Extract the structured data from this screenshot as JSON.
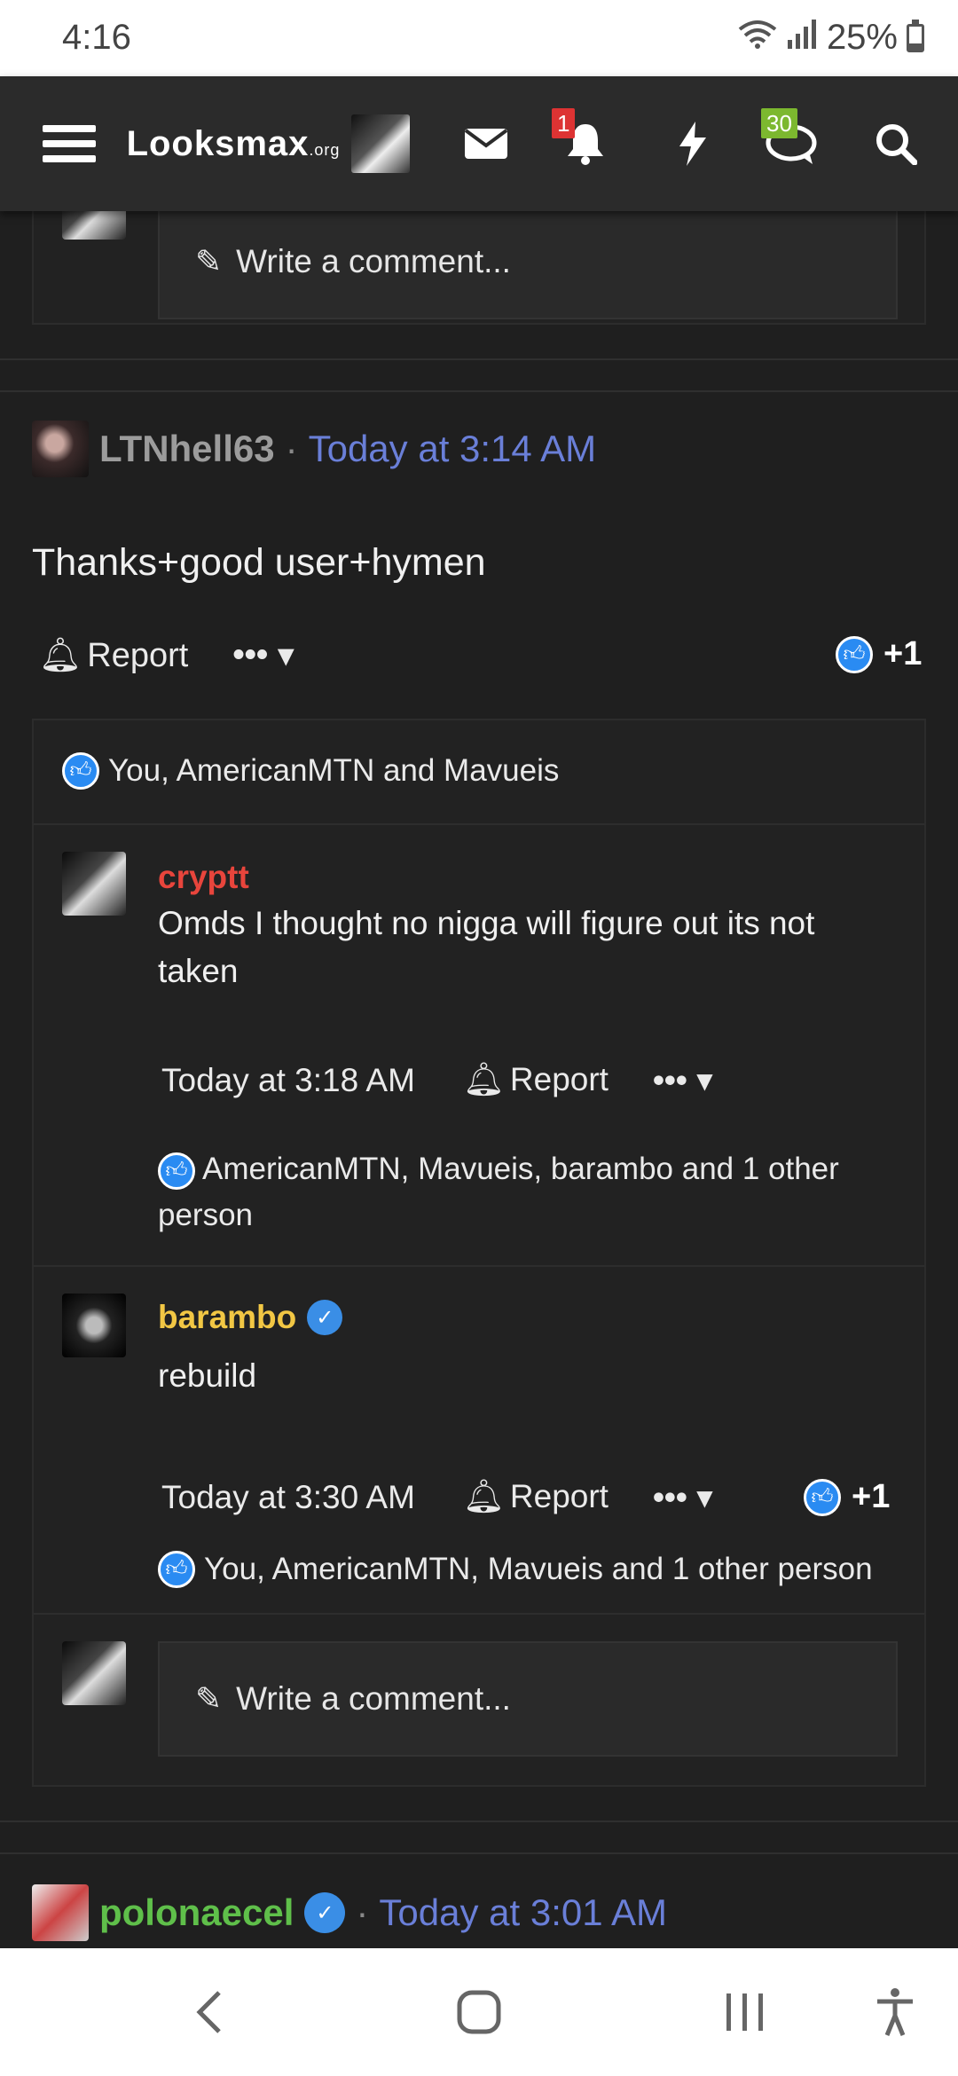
{
  "status_bar": {
    "time": "4:16",
    "battery": "25%",
    "battery_level": 0.25
  },
  "nav": {
    "logo": "Looksmax",
    "logo_suffix": ".org",
    "notifications_badge": "1",
    "likes_badge": "30"
  },
  "top_comment_box": {
    "placeholder": "Write a comment..."
  },
  "post1": {
    "username": "LTNhell63",
    "date": "Today at 3:14 AM",
    "body": "Thanks+good user+hymen",
    "report": "Report",
    "more": "•••",
    "reaction_count": "+1",
    "reactions_text": "You, AmericanMTN and Mavueis"
  },
  "comments": [
    {
      "username": "cryptt",
      "username_color": "#e8453c",
      "text": "Omds I thought no nigga will figure out its not taken",
      "date": "Today at 3:18 AM",
      "report": "Report",
      "more": "•••",
      "reactions_text": "AmericanMTN, Mavueis, barambo and 1 other person"
    },
    {
      "username": "barambo",
      "username_color": "#f2c744",
      "text": "rebuild",
      "date": "Today at 3:30 AM",
      "report": "Report",
      "more": "•••",
      "reaction_count": "+1",
      "reactions_text": "You, AmericanMTN, Mavueis and 1 other person"
    }
  ],
  "post1_comment_box": {
    "placeholder": "Write a comment..."
  },
  "post2": {
    "username": "polonaecel",
    "date": "Today at 3:01 AM"
  },
  "icons": [
    "menu-icon",
    "envelope-icon",
    "bell-icon",
    "bolt-icon",
    "chat-icon",
    "search-icon",
    "pencil-icon",
    "thumbs-up-icon",
    "verified-icon",
    "back-icon",
    "home-icon",
    "recents-icon",
    "accessibility-icon"
  ]
}
